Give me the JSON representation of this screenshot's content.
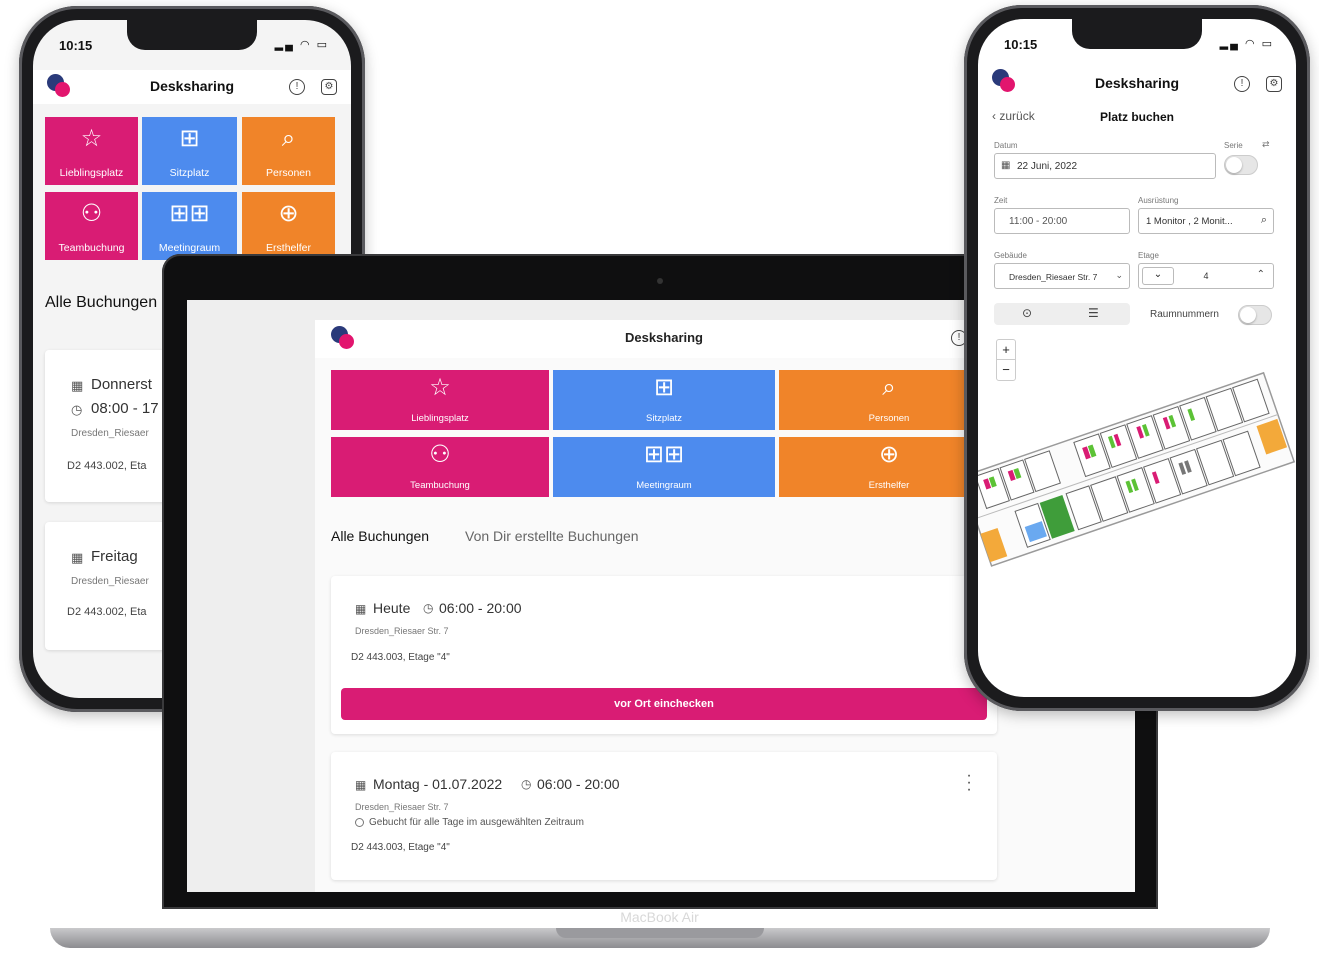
{
  "app": {
    "title": "Desksharing"
  },
  "status": {
    "time": "10:15"
  },
  "tiles": [
    {
      "label": "Lieblingsplatz",
      "icon": "☆",
      "icon_name": "star-icon",
      "color": "#d91c74"
    },
    {
      "label": "Sitzplatz",
      "icon": "⊞",
      "icon_name": "desk-icon",
      "color": "#4d8bee"
    },
    {
      "label": "Personen",
      "icon": "⌕",
      "icon_name": "search-icon",
      "color": "#f08429"
    },
    {
      "label": "Teambuchung",
      "icon": "⚇",
      "icon_name": "team-icon",
      "color": "#d91c74"
    },
    {
      "label": "Meetingraum",
      "icon": "⊞⊞",
      "icon_name": "meeting-room-icon",
      "color": "#4d8bee"
    },
    {
      "label": "Ersthelfer",
      "icon": "⊕",
      "icon_name": "first-aid-plus-icon",
      "color": "#f08429"
    }
  ],
  "left_phone": {
    "section_title": "Alle Buchungen",
    "bookings": [
      {
        "day": "Donnerst",
        "time": "08:00 - 17",
        "location": "Dresden_Riesaer",
        "desk": "D2 443.002, Eta"
      },
      {
        "day": "Freitag",
        "location": "Dresden_Riesaer",
        "desk": "D2 443.002, Eta"
      }
    ]
  },
  "laptop": {
    "tabs": [
      "Alle Buchungen",
      "Von Dir erstellte Buchungen"
    ],
    "bookings": [
      {
        "day": "Heute",
        "time": "06:00 - 20:00",
        "location": "Dresden_Riesaer Str. 7",
        "desk": "D2 443.003, Etage \"4\"",
        "action": "vor Ort einchecken"
      },
      {
        "day": "Montag - 01.07.2022",
        "time": "06:00 - 20:00",
        "location": "Dresden_Riesaer Str. 7",
        "note": "Gebucht für alle Tage im ausgewählten Zeitraum",
        "desk": "D2 443.003, Etage \"4\""
      }
    ],
    "device_label": "MacBook Air",
    "colors": {
      "accent": "#d91c74"
    }
  },
  "right_phone": {
    "back_label": "zurück",
    "page_title": "Platz buchen",
    "fields": {
      "date_label": "Datum",
      "date_value": "22 Juni, 2022",
      "series_label": "Serie",
      "time_label": "Zeit",
      "time_value": "11:00 - 20:00",
      "equipment_label": "Ausrüstung",
      "equipment_value": "1 Monitor , 2 Monit...",
      "building_label": "Gebäude",
      "building_value": "Dresden_Riesaer Str. 7",
      "floor_label": "Etage",
      "floor_value": "4",
      "room_numbers_label": "Raumnummern"
    },
    "zoom_in": "+",
    "zoom_out": "−"
  }
}
